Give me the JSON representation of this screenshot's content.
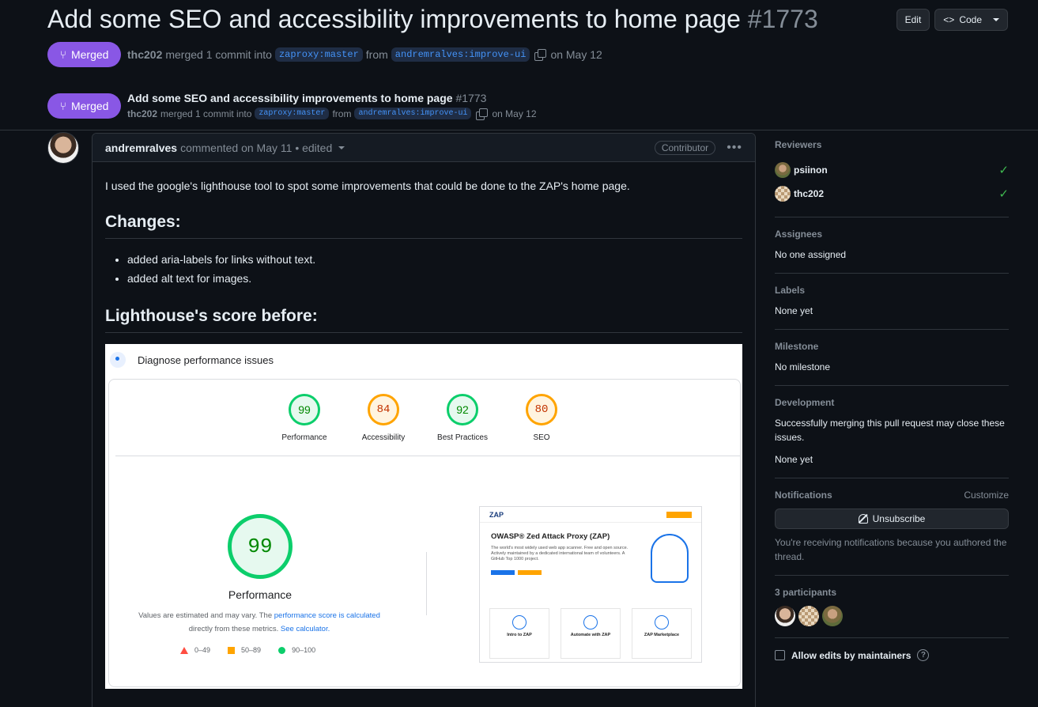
{
  "header": {
    "title": "Add some SEO and accessibility improvements to home page",
    "number": "#1773",
    "edit_label": "Edit",
    "code_label": "Code",
    "status": "Merged",
    "author": "thc202",
    "merged_text": "merged 1 commit into",
    "base_branch": "zaproxy:master",
    "from_text": "from",
    "head_branch": "andremralves:improve-ui",
    "date": "on May 12"
  },
  "comment": {
    "author": "andremralves",
    "meta": "commented on May 11 • edited",
    "role": "Contributor",
    "intro": "I used the google's lighthouse tool to spot some improvements that could be done to the ZAP's home page.",
    "changes_heading": "Changes:",
    "changes": [
      "added aria-labels for links without text.",
      "added alt text for images."
    ],
    "before_heading": "Lighthouse's score before:"
  },
  "lighthouse": {
    "title": "Diagnose performance issues",
    "scores": [
      {
        "value": "99",
        "label": "Performance",
        "color": "#0cce6b"
      },
      {
        "value": "84",
        "label": "Accessibility",
        "color": "#ffa400"
      },
      {
        "value": "92",
        "label": "Best Practices",
        "color": "#0cce6b"
      },
      {
        "value": "80",
        "label": "SEO",
        "color": "#ffa400"
      }
    ],
    "main_score": "99",
    "main_label": "Performance",
    "note_pre": "Values are estimated and may vary. The",
    "note_link1": "performance score is calculated",
    "note_mid": "directly from these metrics.",
    "note_link2": "See calculator.",
    "legend": [
      "0–49",
      "50–89",
      "90–100"
    ],
    "preview": {
      "brand": "ZAP",
      "headline": "OWASP® Zed Attack Proxy (ZAP)",
      "blurb": "The world's most widely used web app scanner. Free and open source. Actively maintained by a dedicated international team of volunteers. A GitHub Top 1000 project.",
      "cards": [
        "Intro to ZAP",
        "Automate with ZAP",
        "ZAP Marketplace"
      ]
    }
  },
  "sidebar": {
    "reviewers_label": "Reviewers",
    "reviewers": [
      "psiinon",
      "thc202"
    ],
    "assignees_label": "Assignees",
    "assignees_value": "No one assigned",
    "labels_label": "Labels",
    "labels_value": "None yet",
    "milestone_label": "Milestone",
    "milestone_value": "No milestone",
    "development_label": "Development",
    "development_text": "Successfully merging this pull request may close these issues.",
    "development_value": "None yet",
    "notifications_label": "Notifications",
    "customize_label": "Customize",
    "unsubscribe_label": "Unsubscribe",
    "notifications_note": "You're receiving notifications because you authored the thread.",
    "participants_label": "3 participants",
    "allow_edits_label": "Allow edits by maintainers"
  },
  "colors": {
    "merged": "#8957e5",
    "link": "#4493f8",
    "success": "#3fb950"
  }
}
